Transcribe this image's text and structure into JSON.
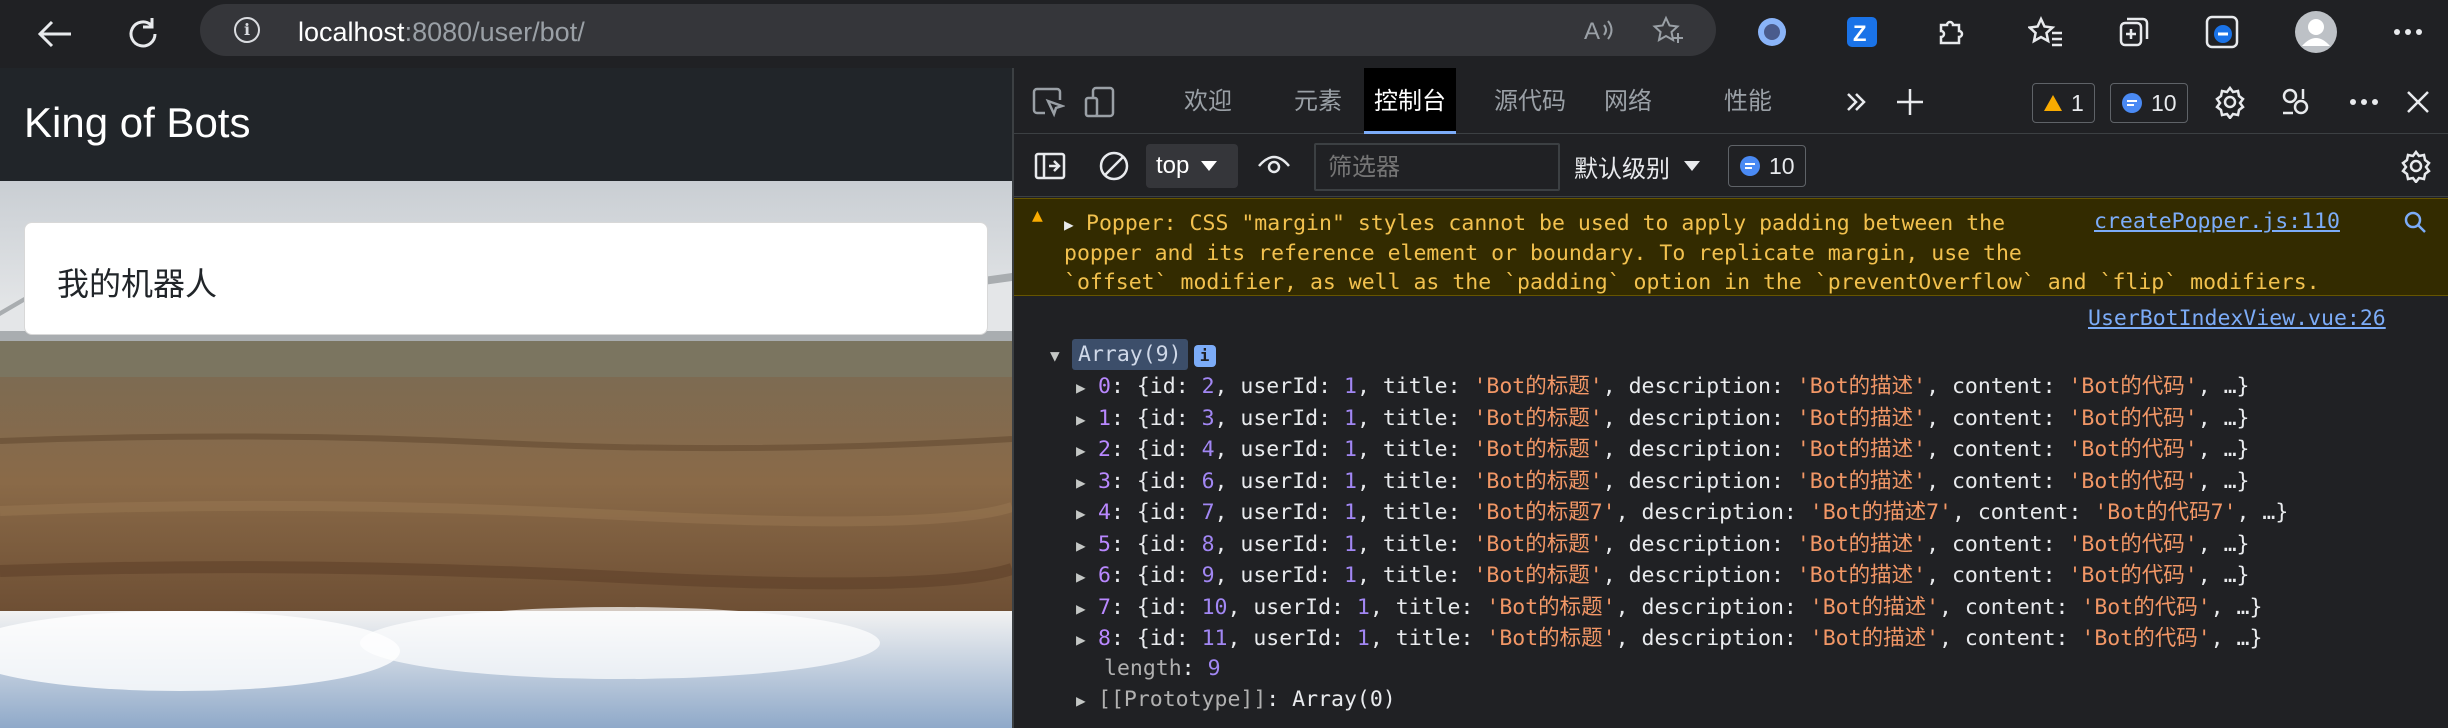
{
  "browser": {
    "url_host": "localhost",
    "url_rest": ":8080/user/bot/"
  },
  "page": {
    "brand": "King of Bots",
    "card_title": "我的机器人"
  },
  "devtools": {
    "tabs": [
      "欢迎",
      "元素",
      "控制台",
      "源代码",
      "网络",
      "性能"
    ],
    "active_tab": "控制台",
    "warning_count": "1",
    "message_count": "10",
    "toolbar": {
      "context": "top",
      "filter_placeholder": "筛选器",
      "level": "默认级别",
      "message_count": "10"
    },
    "console": {
      "warning_message": "Popper: CSS \"margin\" styles cannot be used to apply padding between the\npopper and its reference element or boundary. To replicate margin, use the\n`offset` modifier, as well as the `padding` option in the `preventOverflow` and `flip` modifiers.",
      "warning_source": "createPopper.js:110",
      "log_source": "UserBotIndexView.vue:26",
      "array_label": "Array(9)",
      "items": [
        {
          "index": "0",
          "id": "2",
          "userId": "1",
          "title": "'Bot的标题'",
          "description": "'Bot的描述'",
          "content": "'Bot的代码'"
        },
        {
          "index": "1",
          "id": "3",
          "userId": "1",
          "title": "'Bot的标题'",
          "description": "'Bot的描述'",
          "content": "'Bot的代码'"
        },
        {
          "index": "2",
          "id": "4",
          "userId": "1",
          "title": "'Bot的标题'",
          "description": "'Bot的描述'",
          "content": "'Bot的代码'"
        },
        {
          "index": "3",
          "id": "6",
          "userId": "1",
          "title": "'Bot的标题'",
          "description": "'Bot的描述'",
          "content": "'Bot的代码'"
        },
        {
          "index": "4",
          "id": "7",
          "userId": "1",
          "title": "'Bot的标题7'",
          "description": "'Bot的描述7'",
          "content": "'Bot的代码7'"
        },
        {
          "index": "5",
          "id": "8",
          "userId": "1",
          "title": "'Bot的标题'",
          "description": "'Bot的描述'",
          "content": "'Bot的代码'"
        },
        {
          "index": "6",
          "id": "9",
          "userId": "1",
          "title": "'Bot的标题'",
          "description": "'Bot的描述'",
          "content": "'Bot的代码'"
        },
        {
          "index": "7",
          "id": "10",
          "userId": "1",
          "title": "'Bot的标题'",
          "description": "'Bot的描述'",
          "content": "'Bot的代码'"
        },
        {
          "index": "8",
          "id": "11",
          "userId": "1",
          "title": "'Bot的标题'",
          "description": "'Bot的描述'",
          "content": "'Bot的代码'"
        }
      ],
      "length_key": "length",
      "length_value": "9",
      "prototype_key": "[[Prototype]]",
      "prototype_value": "Array(0)"
    }
  },
  "colors": {
    "warning_bg": "#332b00",
    "warning_text": "#f2c14e",
    "link": "#7cacf8",
    "string": "#f29766",
    "number": "#a287f4"
  }
}
